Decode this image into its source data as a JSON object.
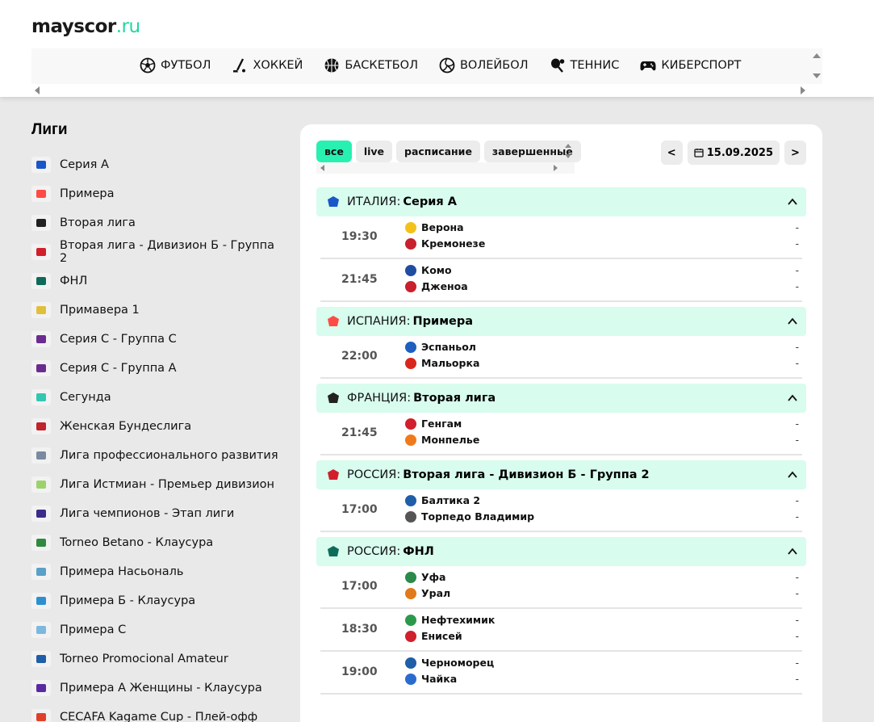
{
  "logo": {
    "brand": "mayscor",
    "tld": ".ru"
  },
  "sports": [
    {
      "label": "ФУТБОЛ",
      "icon": "football-icon"
    },
    {
      "label": "ХОККЕЙ",
      "icon": "hockey-icon"
    },
    {
      "label": "БАСКЕТБОЛ",
      "icon": "basketball-icon"
    },
    {
      "label": "ВОЛЕЙБОЛ",
      "icon": "volleyball-icon"
    },
    {
      "label": "ТЕННИС",
      "icon": "tennis-icon"
    },
    {
      "label": "КИБЕРСПОРТ",
      "icon": "gamepad-icon"
    }
  ],
  "sidebar": {
    "title": "Лиги",
    "items": [
      {
        "label": "Серия А",
        "color": "#1a56c8"
      },
      {
        "label": "Примера",
        "color": "#ff4b44"
      },
      {
        "label": "Вторая лига",
        "color": "#222222"
      },
      {
        "label": "Вторая лига - Дивизион Б - Группа 2",
        "color": "#d11f2c"
      },
      {
        "label": "ФНЛ",
        "color": "#0e6b5a"
      },
      {
        "label": "Примавера 1",
        "color": "#e0c03a"
      },
      {
        "label": "Серия С - Группа С",
        "color": "#6b2c8f"
      },
      {
        "label": "Серия С - Группа А",
        "color": "#6b2c8f"
      },
      {
        "label": "Сегунда",
        "color": "#33c7b0"
      },
      {
        "label": "Женская Бундеслига",
        "color": "#c0242c"
      },
      {
        "label": "Лига профессионального развития",
        "color": "#7a8aa0"
      },
      {
        "label": "Лига Истмиан - Премьер дивизион",
        "color": "#9cd26b"
      },
      {
        "label": "Лига чемпионов - Этап лиги",
        "color": "#3b2b8a"
      },
      {
        "label": "Torneo Betano - Клаусура",
        "color": "#2f8a3e"
      },
      {
        "label": "Примера Насьональ",
        "color": "#5aa0c8"
      },
      {
        "label": "Примера Б - Клаусура",
        "color": "#2e8fd0"
      },
      {
        "label": "Примера С",
        "color": "#7cb8e0"
      },
      {
        "label": "Torneo Promocional Amateur",
        "color": "#1f5ea8"
      },
      {
        "label": "Примера А Женщины - Клаусура",
        "color": "#5a2aa0"
      },
      {
        "label": "CECAFA Kagame Cup - Плей-офф",
        "color": "#e0402a"
      }
    ]
  },
  "filters": {
    "all": "все",
    "live": "live",
    "schedule": "расписание",
    "finished": "завершенные"
  },
  "date": {
    "prev": "<",
    "value": "15.09.2025",
    "next": ">"
  },
  "groups": [
    {
      "country": "ИТАЛИЯ:",
      "league": "Серия А",
      "color": "#1a56c8",
      "matches": [
        {
          "time": "19:30",
          "home": "Верона",
          "away": "Кремонезе",
          "hs": "-",
          "as": "-",
          "hc": "#f2c21b",
          "ac": "#c8202c"
        },
        {
          "time": "21:45",
          "home": "Комо",
          "away": "Дженоа",
          "hs": "-",
          "as": "-",
          "hc": "#1f4ea0",
          "ac": "#c8202c"
        }
      ]
    },
    {
      "country": "ИСПАНИЯ:",
      "league": "Примера",
      "color": "#ff4b44",
      "matches": [
        {
          "time": "22:00",
          "home": "Эспаньол",
          "away": "Мальорка",
          "hs": "-",
          "as": "-",
          "hc": "#1e5fbf",
          "ac": "#d9261c"
        }
      ]
    },
    {
      "country": "ФРАНЦИЯ:",
      "league": "Вторая лига",
      "color": "#222222",
      "matches": [
        {
          "time": "21:45",
          "home": "Генгам",
          "away": "Монпелье",
          "hs": "-",
          "as": "-",
          "hc": "#d11f2c",
          "ac": "#f07a1a"
        }
      ]
    },
    {
      "country": "РОССИЯ:",
      "league": "Вторая лига - Дивизион Б - Группа 2",
      "color": "#d11f2c",
      "matches": [
        {
          "time": "17:00",
          "home": "Балтика 2",
          "away": "Торпедо Владимир",
          "hs": "-",
          "as": "-",
          "hc": "#1f5ea8",
          "ac": "#555555"
        }
      ]
    },
    {
      "country": "РОССИЯ:",
      "league": "ФНЛ",
      "color": "#0e6b5a",
      "matches": [
        {
          "time": "17:00",
          "home": "Уфа",
          "away": "Урал",
          "hs": "-",
          "as": "-",
          "hc": "#2a8a4a",
          "ac": "#e07a1a"
        },
        {
          "time": "18:30",
          "home": "Нефтехимик",
          "away": "Енисей",
          "hs": "-",
          "as": "-",
          "hc": "#2a9a4a",
          "ac": "#d11f2c"
        },
        {
          "time": "19:00",
          "home": "Черноморец",
          "away": "Чайка",
          "hs": "-",
          "as": "-",
          "hc": "#1f5ea8",
          "ac": "#2a6bd0"
        }
      ]
    }
  ],
  "colors": {
    "accent": "#28f0b0",
    "group_bg": "#d8fcee",
    "tld": "#1fd8a0"
  }
}
